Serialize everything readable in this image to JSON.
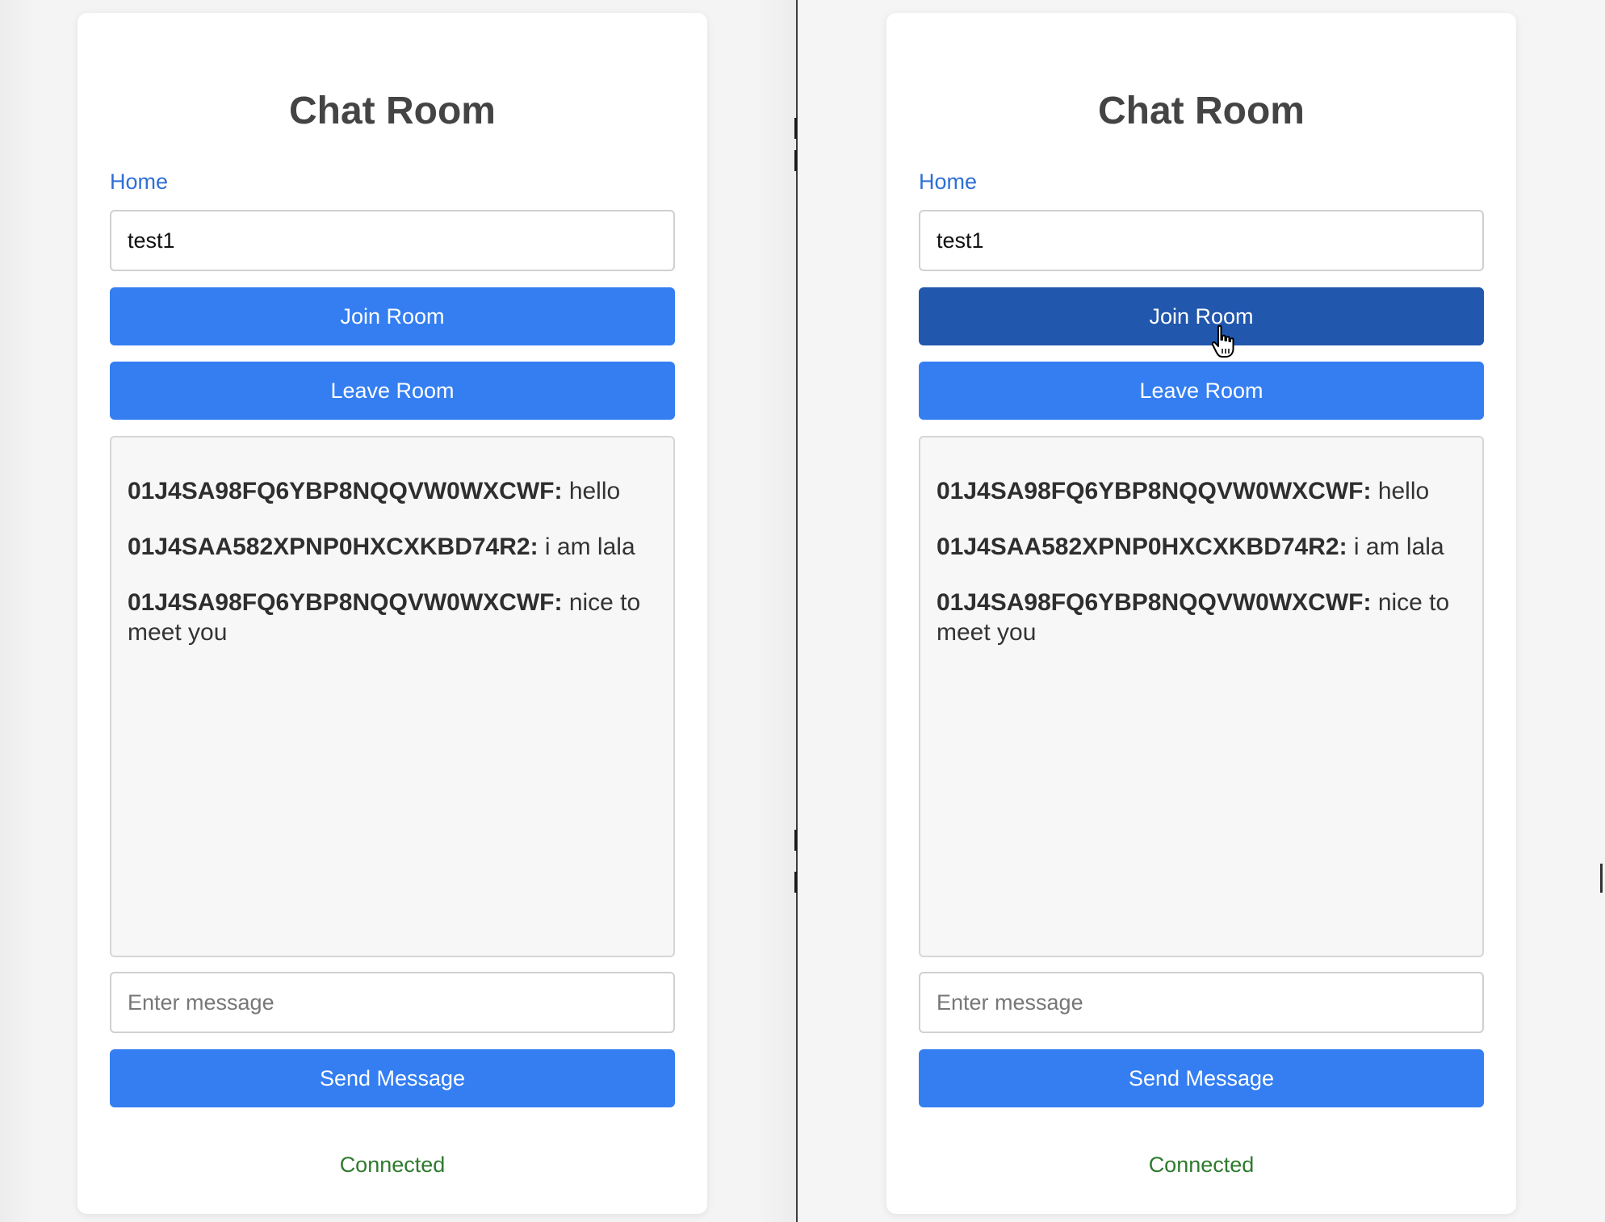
{
  "colors": {
    "accent": "#347ef2",
    "accent_hover": "#2157ad",
    "link": "#2f6fd6",
    "status_ok": "#2e7a2e",
    "title": "#444444"
  },
  "panes": [
    {
      "title": "Chat Room",
      "home_link": "Home",
      "room_input": {
        "value": "test1"
      },
      "join_button": "Join Room",
      "leave_button": "Leave Room",
      "messages": [
        {
          "sender": "01J4SA98FQ6YBP8NQQVW0WXCWF:",
          "text": "hello"
        },
        {
          "sender": "01J4SAA582XPNP0HXCXKBD74R2:",
          "text": "i am lala"
        },
        {
          "sender": "01J4SA98FQ6YBP8NQQVW0WXCWF:",
          "text": "nice to meet you"
        }
      ],
      "message_input": {
        "value": "",
        "placeholder": "Enter message"
      },
      "send_button": "Send Message",
      "status": "Connected"
    },
    {
      "title": "Chat Room",
      "home_link": "Home",
      "room_input": {
        "value": "test1"
      },
      "join_button": "Join Room",
      "leave_button": "Leave Room",
      "messages": [
        {
          "sender": "01J4SA98FQ6YBP8NQQVW0WXCWF:",
          "text": "hello"
        },
        {
          "sender": "01J4SAA582XPNP0HXCXKBD74R2:",
          "text": "i am lala"
        },
        {
          "sender": "01J4SA98FQ6YBP8NQQVW0WXCWF:",
          "text": "nice to meet you"
        }
      ],
      "message_input": {
        "value": "",
        "placeholder": "Enter message"
      },
      "send_button": "Send Message",
      "status": "Connected"
    }
  ],
  "cursor_icon": "hand-pointer-icon"
}
